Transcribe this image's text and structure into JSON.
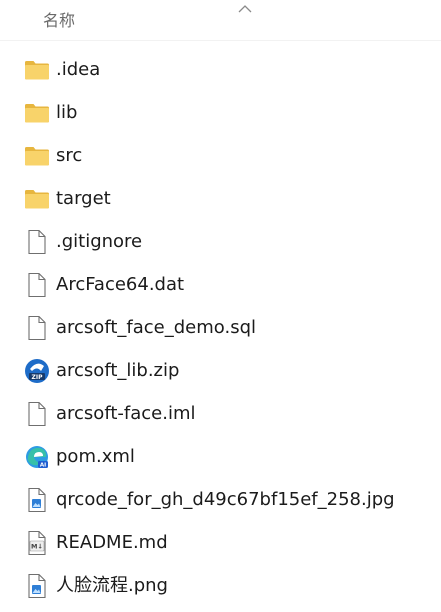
{
  "header": {
    "name_column_label": "名称",
    "sort_icon": "sort-ascending-chevron-icon"
  },
  "files": [
    {
      "name": ".idea",
      "icon": "folder-icon"
    },
    {
      "name": "lib",
      "icon": "folder-icon"
    },
    {
      "name": "src",
      "icon": "folder-icon"
    },
    {
      "name": "target",
      "icon": "folder-icon"
    },
    {
      "name": ".gitignore",
      "icon": "blank-file-icon"
    },
    {
      "name": "ArcFace64.dat",
      "icon": "blank-file-icon"
    },
    {
      "name": "arcsoft_face_demo.sql",
      "icon": "blank-file-icon"
    },
    {
      "name": "arcsoft_lib.zip",
      "icon": "zip-archive-icon"
    },
    {
      "name": "arcsoft-face.iml",
      "icon": "blank-file-icon"
    },
    {
      "name": "pom.xml",
      "icon": "edge-browser-file-icon"
    },
    {
      "name": "qrcode_for_gh_d49c67bf15ef_258.jpg",
      "icon": "image-file-icon"
    },
    {
      "name": "README.md",
      "icon": "markdown-file-icon"
    },
    {
      "name": "人脸流程.png",
      "icon": "image-file-icon"
    }
  ],
  "colors": {
    "folder_yellow": "#F8D36A",
    "folder_dark": "#E7B63F",
    "text": "#1B1B1B",
    "header_text": "#6A6A6A"
  }
}
